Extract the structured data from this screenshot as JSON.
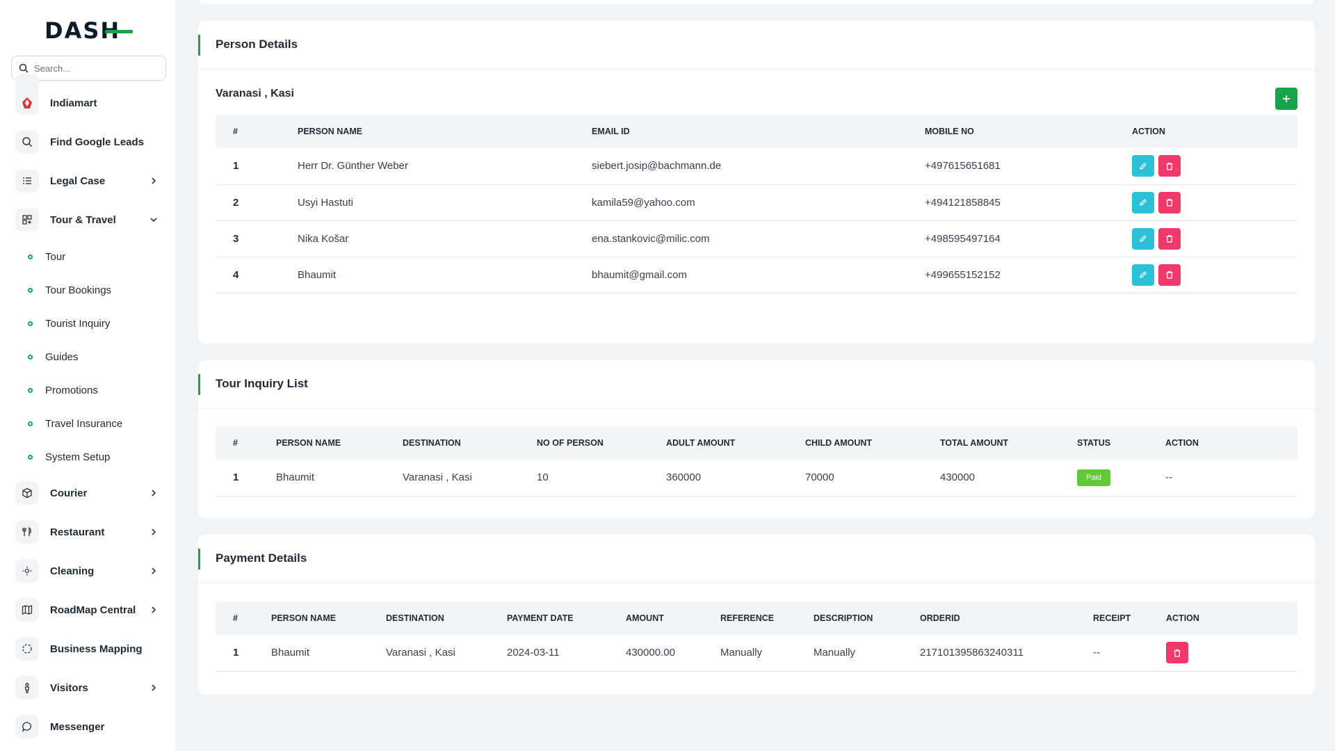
{
  "brand": {
    "logo_text": "DASH"
  },
  "search": {
    "placeholder": "Search..."
  },
  "sidebar": {
    "items": [
      {
        "label": "Indiamart",
        "icon": "indiamart-logo-icon",
        "has_chevron": false
      },
      {
        "label": "Find Google Leads",
        "icon": "search-icon",
        "has_chevron": false
      },
      {
        "label": "Legal Case",
        "icon": "list-icon",
        "has_chevron": true
      },
      {
        "label": "Tour & Travel",
        "icon": "grid-icon",
        "has_chevron": true,
        "expanded": true
      },
      {
        "label": "Courier",
        "icon": "box-icon",
        "has_chevron": true
      },
      {
        "label": "Restaurant",
        "icon": "utensils-icon",
        "has_chevron": true
      },
      {
        "label": "Cleaning",
        "icon": "sun-icon",
        "has_chevron": true
      },
      {
        "label": "RoadMap Central",
        "icon": "map-icon",
        "has_chevron": true
      },
      {
        "label": "Business Mapping",
        "icon": "circle-dashed-icon",
        "has_chevron": false
      },
      {
        "label": "Visitors",
        "icon": "person-icon",
        "has_chevron": true
      },
      {
        "label": "Messenger",
        "icon": "chat-icon",
        "has_chevron": false
      }
    ],
    "sub_items": [
      "Tour",
      "Tour Bookings",
      "Tourist Inquiry",
      "Guides",
      "Promotions",
      "Travel Insurance",
      "System Setup"
    ]
  },
  "person_details": {
    "title": "Person Details",
    "location": "Varanasi , Kasi",
    "headers": [
      "#",
      "PERSON NAME",
      "EMAIL ID",
      "MOBILE NO",
      "ACTION"
    ],
    "rows": [
      {
        "num": "1",
        "name": "Herr Dr. Günther Weber",
        "email": "siebert.josip@bachmann.de",
        "mobile": "+497615651681"
      },
      {
        "num": "2",
        "name": "Usyi Hastuti",
        "email": "kamila59@yahoo.com",
        "mobile": "+494121858845"
      },
      {
        "num": "3",
        "name": "Nika Košar",
        "email": "ena.stankovic@milic.com",
        "mobile": "+498595497164"
      },
      {
        "num": "4",
        "name": "Bhaumit",
        "email": "bhaumit@gmail.com",
        "mobile": "+499655152152"
      }
    ]
  },
  "tour_inquiry": {
    "title": "Tour Inquiry List",
    "headers": [
      "#",
      "PERSON NAME",
      "DESTINATION",
      "NO OF PERSON",
      "ADULT AMOUNT",
      "CHILD AMOUNT",
      "TOTAL AMOUNT",
      "STATUS",
      "ACTION"
    ],
    "rows": [
      {
        "num": "1",
        "name": "Bhaumit",
        "destination": "Varanasi , Kasi",
        "persons": "10",
        "adult": "360000",
        "child": "70000",
        "total": "430000",
        "status": "Paid",
        "action": "--"
      }
    ]
  },
  "payment_details": {
    "title": "Payment Details",
    "headers": [
      "#",
      "PERSON NAME",
      "DESTINATION",
      "PAYMENT DATE",
      "AMOUNT",
      "REFERENCE",
      "DESCRIPTION",
      "ORDERID",
      "RECEIPT",
      "ACTION"
    ],
    "rows": [
      {
        "num": "1",
        "name": "Bhaumit",
        "destination": "Varanasi , Kasi",
        "date": "2024-03-11",
        "amount": "430000.00",
        "reference": "Manually",
        "description": "Manually",
        "orderid": "217101395863240311",
        "receipt": "--"
      }
    ]
  },
  "colors": {
    "accent": "#16a34a",
    "edit": "#2bc1d9",
    "delete": "#f0386b",
    "paid": "#61c837"
  }
}
